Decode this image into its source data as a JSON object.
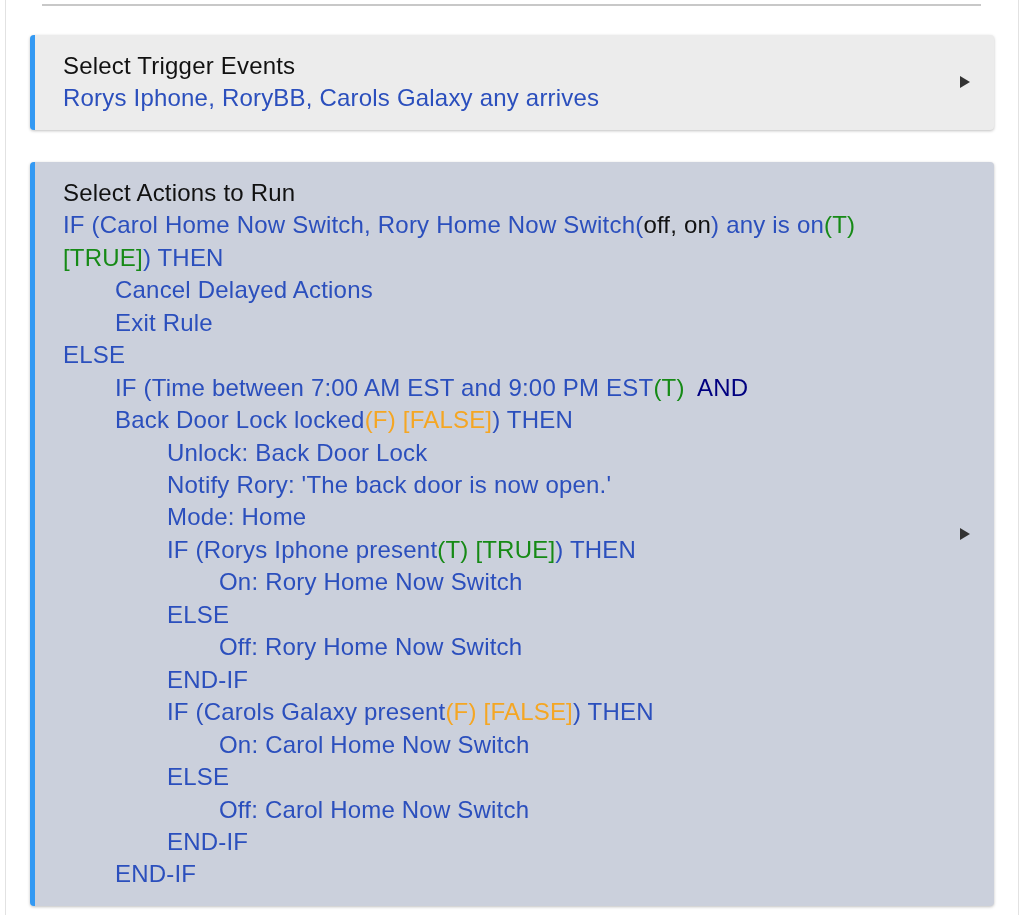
{
  "trigger_section": {
    "title": "Select Trigger Events",
    "summary": "Rorys Iphone, RoryBB, Carols Galaxy any arrives",
    "expanded": false
  },
  "actions_section": {
    "title": "Select Actions to Run",
    "expanded": false,
    "rule": [
      {
        "lines": [
          [
            {
              "kind": "text",
              "text": "IF (Carol Home Now Switch, Rory Home Now Switch("
            },
            {
              "kind": "value",
              "text": "off, on"
            },
            {
              "kind": "text",
              "text": ") any is on"
            },
            {
              "kind": "true",
              "text": "(T)"
            }
          ],
          [
            {
              "kind": "true",
              "text": "[TRUE]"
            },
            {
              "kind": "text",
              "text": ") THEN"
            }
          ]
        ],
        "children": [
          {
            "lines": [
              [
                {
                  "kind": "text",
                  "text": "Cancel Delayed Actions"
                }
              ]
            ]
          },
          {
            "lines": [
              [
                {
                  "kind": "text",
                  "text": "Exit Rule"
                }
              ]
            ]
          }
        ]
      },
      {
        "lines": [
          [
            {
              "kind": "text",
              "text": "ELSE"
            }
          ]
        ],
        "children": [
          {
            "lines": [
              [
                {
                  "kind": "text",
                  "text": "IF (Time between 7:00 AM EST and 9:00 PM EST"
                },
                {
                  "kind": "true",
                  "text": "(T)"
                },
                {
                  "kind": "operator",
                  "text": "  AND"
                }
              ],
              [
                {
                  "kind": "text",
                  "text": "Back Door Lock locked"
                },
                {
                  "kind": "false",
                  "text": "(F) [FALSE]"
                },
                {
                  "kind": "text",
                  "text": ") THEN"
                }
              ]
            ],
            "children": [
              {
                "lines": [
                  [
                    {
                      "kind": "text",
                      "text": "Unlock: Back Door Lock"
                    }
                  ]
                ]
              },
              {
                "lines": [
                  [
                    {
                      "kind": "text",
                      "text": "Notify Rory: 'The back door is now open.'"
                    }
                  ]
                ]
              },
              {
                "lines": [
                  [
                    {
                      "kind": "text",
                      "text": "Mode: Home"
                    }
                  ]
                ]
              },
              {
                "lines": [
                  [
                    {
                      "kind": "text",
                      "text": "IF (Rorys Iphone present"
                    },
                    {
                      "kind": "true",
                      "text": "(T) [TRUE]"
                    },
                    {
                      "kind": "text",
                      "text": ") THEN"
                    }
                  ]
                ],
                "children": [
                  {
                    "lines": [
                      [
                        {
                          "kind": "text",
                          "text": "On: Rory Home Now Switch"
                        }
                      ]
                    ]
                  }
                ]
              },
              {
                "lines": [
                  [
                    {
                      "kind": "text",
                      "text": "ELSE"
                    }
                  ]
                ],
                "children": [
                  {
                    "lines": [
                      [
                        {
                          "kind": "text",
                          "text": "Off: Rory Home Now Switch"
                        }
                      ]
                    ]
                  }
                ]
              },
              {
                "lines": [
                  [
                    {
                      "kind": "text",
                      "text": "END-IF"
                    }
                  ]
                ]
              },
              {
                "lines": [
                  [
                    {
                      "kind": "text",
                      "text": "IF (Carols Galaxy present"
                    },
                    {
                      "kind": "false",
                      "text": "(F) [FALSE]"
                    },
                    {
                      "kind": "text",
                      "text": ") THEN"
                    }
                  ]
                ],
                "children": [
                  {
                    "lines": [
                      [
                        {
                          "kind": "text",
                          "text": "On: Carol Home Now Switch"
                        }
                      ]
                    ]
                  }
                ]
              },
              {
                "lines": [
                  [
                    {
                      "kind": "text",
                      "text": "ELSE"
                    }
                  ]
                ],
                "children": [
                  {
                    "lines": [
                      [
                        {
                          "kind": "text",
                          "text": "Off: Carol Home Now Switch"
                        }
                      ]
                    ]
                  }
                ]
              },
              {
                "lines": [
                  [
                    {
                      "kind": "text",
                      "text": "END-IF"
                    }
                  ]
                ]
              }
            ]
          },
          {
            "lines": [
              [
                {
                  "kind": "text",
                  "text": "END-IF"
                }
              ]
            ]
          }
        ]
      }
    ]
  }
}
